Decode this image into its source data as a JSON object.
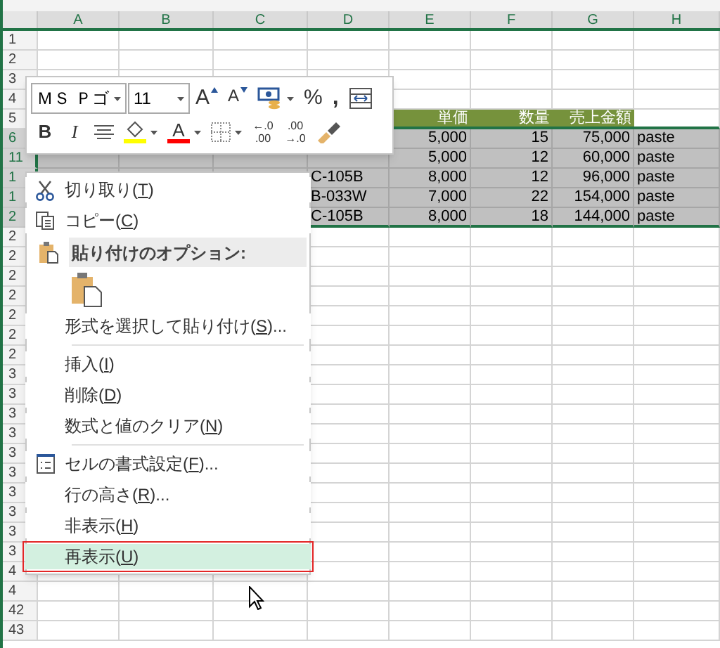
{
  "columns": [
    "A",
    "B",
    "C",
    "D",
    "E",
    "F",
    "G",
    "H"
  ],
  "rows": [
    {
      "label": "1",
      "selected": false,
      "kind": "blank",
      "cells": [
        null,
        null,
        null,
        null,
        null,
        null,
        null,
        null
      ]
    },
    {
      "label": "2",
      "selected": false,
      "kind": "blank",
      "cells": [
        null,
        null,
        null,
        null,
        null,
        null,
        null,
        null
      ]
    },
    {
      "label": "3",
      "selected": false,
      "kind": "blank",
      "cells": [
        null,
        null,
        null,
        null,
        null,
        null,
        null,
        null
      ]
    },
    {
      "label": "4",
      "selected": false,
      "kind": "blank",
      "cells": [
        null,
        null,
        null,
        null,
        null,
        null,
        null,
        null
      ]
    },
    {
      "label": "5",
      "selected": false,
      "kind": "header",
      "cells": [
        null,
        null,
        null,
        null,
        "単価",
        "数量",
        "売上金額",
        null
      ]
    },
    {
      "label": "6",
      "selected": true,
      "kind": "data",
      "cells": [
        null,
        null,
        null,
        null,
        "5,000",
        "15",
        "75,000",
        "paste"
      ]
    },
    {
      "label": "11",
      "selected": true,
      "kind": "data",
      "cells": [
        null,
        null,
        null,
        null,
        "5,000",
        "12",
        "60,000",
        "paste"
      ]
    },
    {
      "label": "1",
      "selected": true,
      "kind": "data",
      "cells": [
        null,
        null,
        null,
        "C-105B",
        "8,000",
        "12",
        "96,000",
        "paste"
      ]
    },
    {
      "label": "1",
      "selected": true,
      "kind": "data",
      "cells": [
        null,
        null,
        null,
        "B-033W",
        "7,000",
        "22",
        "154,000",
        "paste"
      ]
    },
    {
      "label": "2",
      "selected": true,
      "kind": "data",
      "cells": [
        null,
        null,
        null,
        "C-105B",
        "8,000",
        "18",
        "144,000",
        "paste"
      ]
    },
    {
      "label": "2",
      "selected": false,
      "kind": "blank",
      "cells": [
        null,
        null,
        null,
        null,
        null,
        null,
        null,
        null
      ]
    },
    {
      "label": "2",
      "selected": false,
      "kind": "blank",
      "cells": [
        null,
        null,
        null,
        null,
        null,
        null,
        null,
        null
      ]
    },
    {
      "label": "2",
      "selected": false,
      "kind": "blank",
      "cells": [
        null,
        null,
        null,
        null,
        null,
        null,
        null,
        null
      ]
    },
    {
      "label": "2",
      "selected": false,
      "kind": "blank",
      "cells": [
        null,
        null,
        null,
        null,
        null,
        null,
        null,
        null
      ]
    },
    {
      "label": "2",
      "selected": false,
      "kind": "blank",
      "cells": [
        null,
        null,
        null,
        null,
        null,
        null,
        null,
        null
      ]
    },
    {
      "label": "2",
      "selected": false,
      "kind": "blank",
      "cells": [
        null,
        null,
        null,
        null,
        null,
        null,
        null,
        null
      ]
    },
    {
      "label": "2",
      "selected": false,
      "kind": "blank",
      "cells": [
        null,
        null,
        null,
        null,
        null,
        null,
        null,
        null
      ]
    },
    {
      "label": "3",
      "selected": false,
      "kind": "blank",
      "cells": [
        null,
        null,
        null,
        null,
        null,
        null,
        null,
        null
      ]
    },
    {
      "label": "3",
      "selected": false,
      "kind": "blank",
      "cells": [
        null,
        null,
        null,
        null,
        null,
        null,
        null,
        null
      ]
    },
    {
      "label": "3",
      "selected": false,
      "kind": "blank",
      "cells": [
        null,
        null,
        null,
        null,
        null,
        null,
        null,
        null
      ]
    },
    {
      "label": "3",
      "selected": false,
      "kind": "blank",
      "cells": [
        null,
        null,
        null,
        null,
        null,
        null,
        null,
        null
      ]
    },
    {
      "label": "3",
      "selected": false,
      "kind": "blank",
      "cells": [
        null,
        null,
        null,
        null,
        null,
        null,
        null,
        null
      ]
    },
    {
      "label": "3",
      "selected": false,
      "kind": "blank",
      "cells": [
        null,
        null,
        null,
        null,
        null,
        null,
        null,
        null
      ]
    },
    {
      "label": "3",
      "selected": false,
      "kind": "blank",
      "cells": [
        null,
        null,
        null,
        null,
        null,
        null,
        null,
        null
      ]
    },
    {
      "label": "3",
      "selected": false,
      "kind": "blank",
      "cells": [
        null,
        null,
        null,
        null,
        null,
        null,
        null,
        null
      ]
    },
    {
      "label": "3",
      "selected": false,
      "kind": "blank",
      "cells": [
        null,
        null,
        null,
        null,
        null,
        null,
        null,
        null
      ]
    },
    {
      "label": "3",
      "selected": false,
      "kind": "blank",
      "cells": [
        null,
        null,
        null,
        null,
        null,
        null,
        null,
        null
      ]
    },
    {
      "label": "4",
      "selected": false,
      "kind": "blank",
      "cells": [
        null,
        null,
        null,
        null,
        null,
        null,
        null,
        null
      ]
    },
    {
      "label": "4",
      "selected": false,
      "kind": "blank",
      "cells": [
        null,
        null,
        null,
        null,
        null,
        null,
        null,
        null
      ]
    },
    {
      "label": "42",
      "selected": false,
      "kind": "blank",
      "cells": [
        null,
        null,
        null,
        null,
        null,
        null,
        null,
        null
      ]
    },
    {
      "label": "43",
      "selected": false,
      "kind": "blank",
      "cells": [
        null,
        null,
        null,
        null,
        null,
        null,
        null,
        null
      ]
    }
  ],
  "mini_toolbar": [
    [
      {
        "kind": "font-select",
        "text": "ＭＳ Ｐゴ"
      },
      {
        "kind": "size-select",
        "text": "11"
      },
      {
        "kind": "grow",
        "text": "A"
      },
      {
        "kind": "shrink",
        "text": "A"
      },
      {
        "kind": "accounting"
      },
      {
        "kind": "percent",
        "text": "%"
      },
      {
        "kind": "comma",
        "text": ","
      },
      {
        "kind": "wrap"
      }
    ],
    [
      {
        "kind": "bold",
        "text": "B"
      },
      {
        "kind": "italic",
        "text": "I"
      },
      {
        "kind": "align"
      },
      {
        "kind": "fill-color"
      },
      {
        "kind": "font-color",
        "text": "A"
      },
      {
        "kind": "borders"
      },
      {
        "kind": "decimal",
        "lines": [
          "←.0",
          ".00"
        ]
      },
      {
        "kind": "decimal",
        "lines": [
          ".00",
          "→.0"
        ]
      },
      {
        "kind": "painter"
      }
    ]
  ],
  "context_menu": [
    {
      "kind": "cut",
      "before": "切り取り(",
      "key": "T",
      "after": ")",
      "selected": false
    },
    {
      "kind": "copy",
      "before": "コピー(",
      "key": "C",
      "after": ")",
      "selected": false
    },
    {
      "kind": "header",
      "text": "貼り付けのオプション:"
    },
    {
      "kind": "paste-options"
    },
    {
      "kind": "item",
      "before": "形式を選択して貼り付け(",
      "key": "S",
      "after": ")...",
      "selected": false
    },
    {
      "kind": "separator"
    },
    {
      "kind": "item",
      "before": "挿入(",
      "key": "I",
      "after": ")",
      "selected": false
    },
    {
      "kind": "item",
      "before": "削除(",
      "key": "D",
      "after": ")",
      "selected": false
    },
    {
      "kind": "item",
      "before": "数式と値のクリア(",
      "key": "N",
      "after": ")",
      "selected": false
    },
    {
      "kind": "separator"
    },
    {
      "kind": "format",
      "before": "セルの書式設定(",
      "key": "F",
      "after": ")...",
      "selected": false
    },
    {
      "kind": "item",
      "before": "行の高さ(",
      "key": "R",
      "after": ")...",
      "selected": false
    },
    {
      "kind": "item",
      "before": "非表示(",
      "key": "H",
      "after": ")",
      "selected": false
    },
    {
      "kind": "item",
      "before": "再表示(",
      "key": "U",
      "after": ")",
      "selected": true
    }
  ]
}
